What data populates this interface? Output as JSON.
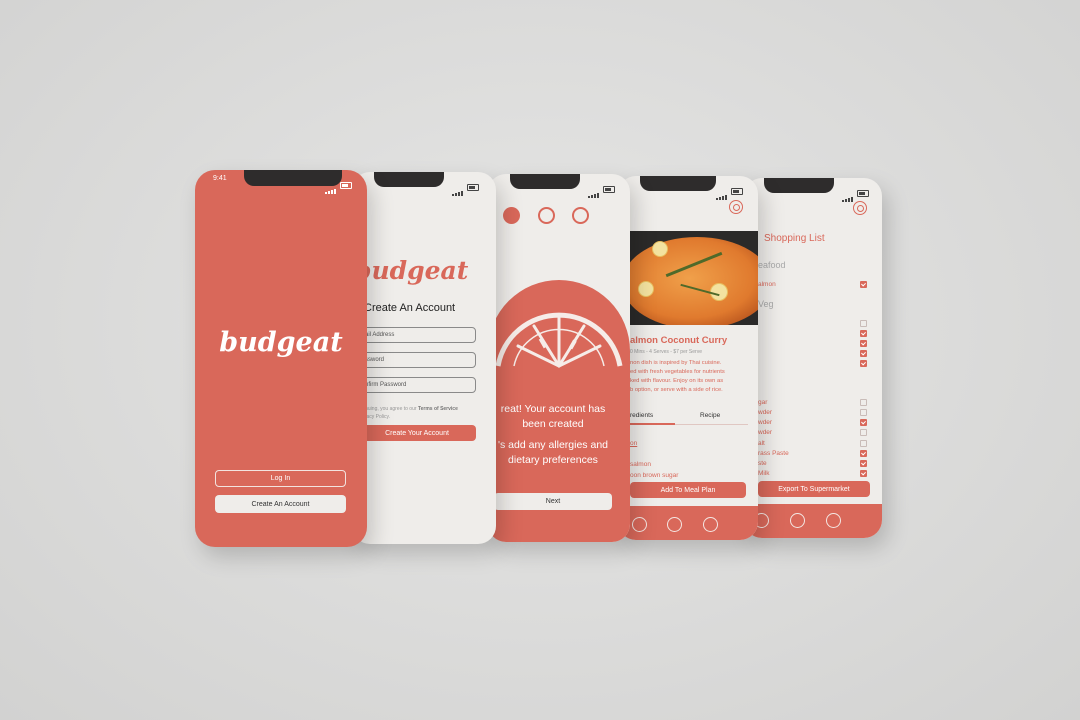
{
  "brand": "budgeat",
  "colors": {
    "coral": "#d9685a",
    "cream": "#efedea",
    "backdrop": "#dcdcdb"
  },
  "screen1": {
    "time": "9:41",
    "login": "Log In",
    "create": "Create An Account"
  },
  "screen2": {
    "title": "Create An Account",
    "email": "ail Address",
    "password": "ssword",
    "confirm": "nfirm Password",
    "terms_a": "inuing, you agree to our ",
    "terms_b": "Terms of Service",
    "terms_c": "vacy Policy.",
    "submit": "Create Your Account"
  },
  "screen3": {
    "msg1a": "reat! Your account has",
    "msg1b": "been created",
    "msg2a": "'s add any allergies and",
    "msg2b": "dietary preferences",
    "next": "Next",
    "pager": [
      "active",
      "inactive",
      "inactive"
    ]
  },
  "screen4": {
    "settings_icon": "gear-icon",
    "title": "almon Coconut Curry",
    "meta": "0 Mins - 4 Serves - $7 per Serve",
    "desc": [
      "non dish is inspired by Thai cuisine.",
      "ed with fresh vegetables for nutrients",
      "ked with flavour. Enjoy on its own as",
      "b option, or serve with a side of rice."
    ],
    "tab_active": "redients",
    "tab_inactive": "Recipe",
    "section": "on",
    "items": [
      "salmon",
      "oon brown sugar"
    ],
    "cta": "Add To Meal Plan"
  },
  "screen5": {
    "title": "Shopping List",
    "cat1": "eafood",
    "cat1_items": [
      {
        "label": "almon",
        "checked": true
      }
    ],
    "cat2": "Veg",
    "cat2_checks": [
      false,
      true,
      true,
      true,
      true
    ],
    "cat3_items": [
      {
        "label": "gar",
        "checked": false
      },
      {
        "label": "wder",
        "checked": false
      },
      {
        "label": "wder",
        "checked": true
      },
      {
        "label": "wder",
        "checked": false
      },
      {
        "label": "alt",
        "checked": false
      },
      {
        "label": "rass Paste",
        "checked": true
      },
      {
        "label": "ste",
        "checked": true
      },
      {
        "label": "Milk",
        "checked": true
      }
    ],
    "cta": "Export To Supermarket"
  },
  "nav_icons": [
    "home-icon",
    "list-icon",
    "basket-icon"
  ]
}
